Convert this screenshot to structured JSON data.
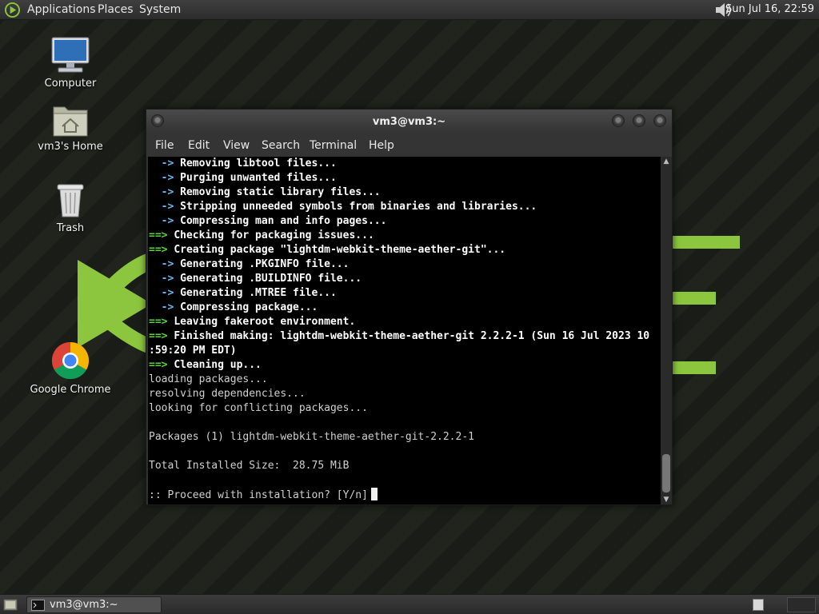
{
  "top_panel": {
    "menus": [
      "Applications",
      "Places",
      "System"
    ],
    "clock": "Sun Jul 16, 22:59"
  },
  "desktop_icons": [
    {
      "label": "Computer",
      "icon": "computer-icon"
    },
    {
      "label": "vm3's Home",
      "icon": "home-folder-icon"
    },
    {
      "label": "Trash",
      "icon": "trash-icon"
    },
    {
      "label": "Google Chrome",
      "icon": "chrome-icon"
    }
  ],
  "terminal": {
    "title": "vm3@vm3:~",
    "menu": [
      "File",
      "Edit",
      "View",
      "Search",
      "Terminal",
      "Help"
    ],
    "lines": [
      {
        "prefix": "  -> ",
        "text": "Removing libtool files...",
        "style": "arrow"
      },
      {
        "prefix": "  -> ",
        "text": "Purging unwanted files...",
        "style": "arrow"
      },
      {
        "prefix": "  -> ",
        "text": "Removing static library files...",
        "style": "arrow"
      },
      {
        "prefix": "  -> ",
        "text": "Stripping unneeded symbols from binaries and libraries...",
        "style": "arrow"
      },
      {
        "prefix": "  -> ",
        "text": "Compressing man and info pages...",
        "style": "arrow"
      },
      {
        "prefix": "==> ",
        "text": "Checking for packaging issues...",
        "style": "green"
      },
      {
        "prefix": "==> ",
        "text": "Creating package \"lightdm-webkit-theme-aether-git\"...",
        "style": "green"
      },
      {
        "prefix": "  -> ",
        "text": "Generating .PKGINFO file...",
        "style": "arrow"
      },
      {
        "prefix": "  -> ",
        "text": "Generating .BUILDINFO file...",
        "style": "arrow"
      },
      {
        "prefix": "  -> ",
        "text": "Generating .MTREE file...",
        "style": "arrow"
      },
      {
        "prefix": "  -> ",
        "text": "Compressing package...",
        "style": "arrow"
      },
      {
        "prefix": "==> ",
        "text": "Leaving fakeroot environment.",
        "style": "green"
      },
      {
        "prefix": "==> ",
        "text": "Finished making: lightdm-webkit-theme-aether-git 2.2.2-1 (Sun 16 Jul 2023 10",
        "style": "green"
      },
      {
        "prefix": "",
        "text": ":59:20 PM EDT)",
        "style": "bold"
      },
      {
        "prefix": "==> ",
        "text": "Cleaning up...",
        "style": "green"
      },
      {
        "prefix": "",
        "text": "loading packages...",
        "style": "plain"
      },
      {
        "prefix": "",
        "text": "resolving dependencies...",
        "style": "plain"
      },
      {
        "prefix": "",
        "text": "looking for conflicting packages...",
        "style": "plain"
      },
      {
        "prefix": "",
        "text": "",
        "style": "plain"
      },
      {
        "prefix": "",
        "text": "Packages (1) lightdm-webkit-theme-aether-git-2.2.2-1",
        "style": "plain"
      },
      {
        "prefix": "",
        "text": "",
        "style": "plain"
      },
      {
        "prefix": "",
        "text": "Total Installed Size:  28.75 MiB",
        "style": "plain"
      },
      {
        "prefix": "",
        "text": "",
        "style": "plain"
      },
      {
        "prefix": "",
        "text": ":: Proceed with installation? [Y/n]",
        "style": "plain"
      }
    ]
  },
  "taskbar": {
    "window_label": "vm3@vm3:~"
  },
  "colors": {
    "accent_green": "#8cc63f",
    "prompt_green": "#5ed23a",
    "arrow_blue": "#6fb6ea"
  }
}
